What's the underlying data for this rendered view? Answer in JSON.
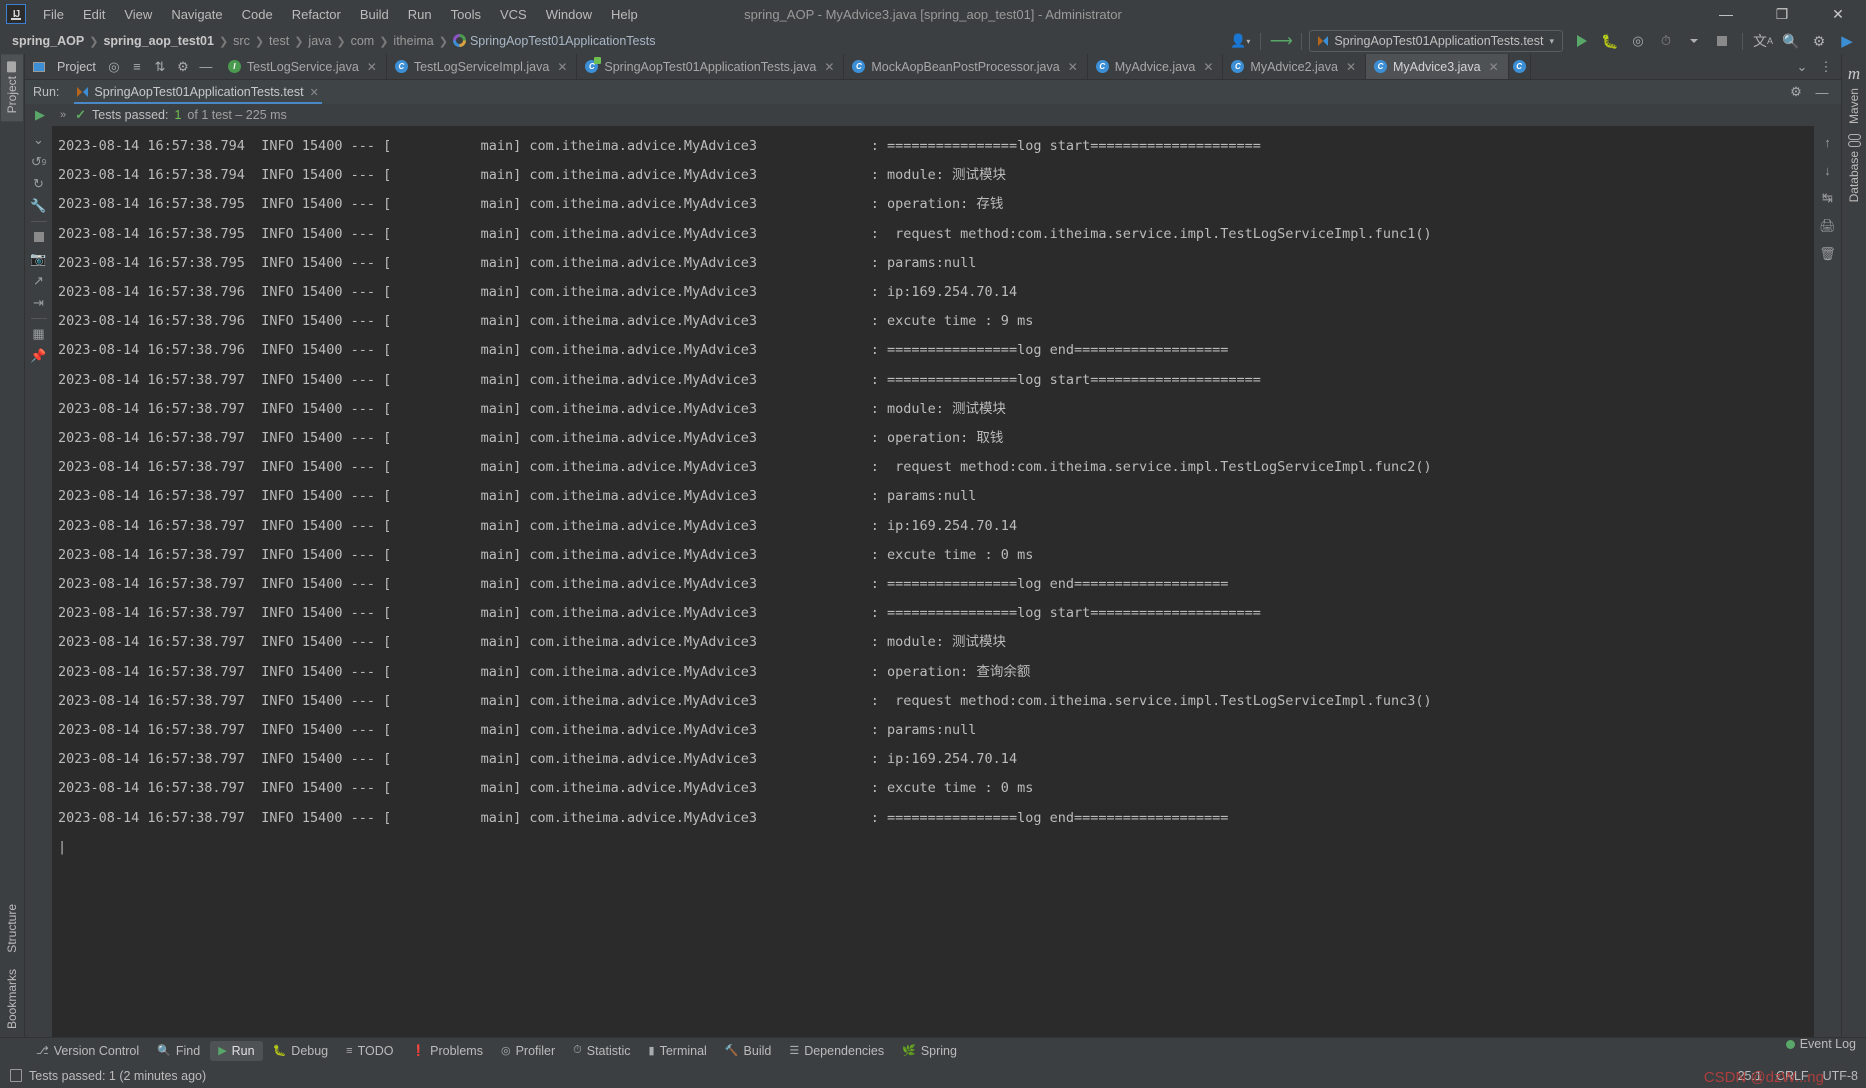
{
  "window": {
    "title": "spring_AOP - MyAdvice3.java [spring_aop_test01] - Administrator",
    "minimize": "—",
    "maximize": "❐",
    "close": "✕"
  },
  "menubar": {
    "items": [
      "File",
      "Edit",
      "View",
      "Navigate",
      "Code",
      "Refactor",
      "Build",
      "Run",
      "Tools",
      "VCS",
      "Window",
      "Help"
    ]
  },
  "breadcrumb": {
    "items": [
      {
        "label": "spring_AOP",
        "style": "bold"
      },
      {
        "label": "spring_aop_test01",
        "style": "bold"
      },
      {
        "label": "src",
        "style": "dim"
      },
      {
        "label": "test",
        "style": "dim"
      },
      {
        "label": "java",
        "style": "dim"
      },
      {
        "label": "com",
        "style": "dim"
      },
      {
        "label": "itheima",
        "style": "dim"
      },
      {
        "label": "SpringAopTest01ApplicationTests",
        "style": "file"
      }
    ],
    "separator": "❯"
  },
  "toolbar": {
    "profile_icon": "user-profile-icon",
    "vcs_update_icon": "vcs-update-arrow-icon",
    "run_config": "SpringAopTest01ApplicationTests.test",
    "run_config_caret": "▾",
    "run_button": "run-icon",
    "debug_button": "debug-icon",
    "run_coverage_button": "run-with-coverage-icon",
    "profiler_button": "profiler-icon",
    "profiler_caret": "▾",
    "stop_button": "stop-icon",
    "translate_button": "translate-icon",
    "search_button": "search-everywhere-icon",
    "settings_button": "settings-gear-icon",
    "ide_logo": "intellij-logo-icon"
  },
  "project_stripe": {
    "label": "Project",
    "icon": "folder-icon",
    "bottom": [
      {
        "label": "Structure",
        "icon": "structure-icon"
      },
      {
        "label": "Bookmarks",
        "icon": "bookmarks-icon"
      }
    ]
  },
  "right_stripe": {
    "maven": "Maven",
    "maven_icon": "maven-m-icon",
    "database": "Database",
    "database_icon": "database-icon"
  },
  "project_toolwindow": {
    "title": "Project",
    "icon": "project-window-icon",
    "actions": [
      "select-opened-file-icon",
      "collapse-all-icon",
      "sort-icon",
      "settings-gear-icon",
      "hide-icon"
    ]
  },
  "editor_tabs": [
    {
      "label": "TestLogService.java",
      "icon": "interface-icon",
      "icon_kind": "iface",
      "active": false
    },
    {
      "label": "TestLogServiceImpl.java",
      "icon": "class-icon",
      "icon_kind": "cls",
      "active": false
    },
    {
      "label": "SpringAopTest01ApplicationTests.java",
      "icon": "test-class-icon",
      "icon_kind": "test",
      "active": false
    },
    {
      "label": "MockAopBeanPostProcessor.java",
      "icon": "class-icon",
      "icon_kind": "cls",
      "active": false
    },
    {
      "label": "MyAdvice.java",
      "icon": "class-icon",
      "icon_kind": "cls",
      "active": false
    },
    {
      "label": "MyAdvice2.java",
      "icon": "class-icon",
      "icon_kind": "cls",
      "active": false
    },
    {
      "label": "MyAdvice3.java",
      "icon": "class-icon",
      "icon_kind": "cls",
      "active": true
    }
  ],
  "editor_tabs_close": "✕",
  "editor_tabs_right": {
    "chevron": "⌄",
    "more": "⋮"
  },
  "run_window": {
    "label": "Run:",
    "tab_title": "SpringAopTest01ApplicationTests.test",
    "tab_close": "✕",
    "settings_icon": "settings-gear-icon",
    "hide_icon": "hide-window-icon",
    "expand_chevron": "»",
    "collapse_chevron": "⌄",
    "status_check": "✓",
    "status_passed": "Tests passed:",
    "status_count": "1",
    "status_detail": "of 1 test – 225 ms"
  },
  "run_gutter_icons": [
    "rerun-icon",
    "rerun-failed-icon",
    "rerun-auto-icon",
    "run-settings-wrench-icon",
    "stop-icon",
    "screenshot-icon",
    "export-icon",
    "import-icon",
    "layout-icon",
    "pin-icon"
  ],
  "console_right_icons": [
    "scroll-up-icon",
    "scroll-down-icon",
    "print-icon",
    "trash-icon"
  ],
  "console": {
    "lines": [
      "2023-08-14 16:57:38.794  INFO 15400 --- [           main] com.itheima.advice.MyAdvice3              : ================log start=====================",
      "2023-08-14 16:57:38.794  INFO 15400 --- [           main] com.itheima.advice.MyAdvice3              : module: 测试模块",
      "2023-08-14 16:57:38.795  INFO 15400 --- [           main] com.itheima.advice.MyAdvice3              : operation: 存钱",
      "2023-08-14 16:57:38.795  INFO 15400 --- [           main] com.itheima.advice.MyAdvice3              :  request method:com.itheima.service.impl.TestLogServiceImpl.func1()",
      "2023-08-14 16:57:38.795  INFO 15400 --- [           main] com.itheima.advice.MyAdvice3              : params:null",
      "2023-08-14 16:57:38.796  INFO 15400 --- [           main] com.itheima.advice.MyAdvice3              : ip:169.254.70.14",
      "2023-08-14 16:57:38.796  INFO 15400 --- [           main] com.itheima.advice.MyAdvice3              : excute time : 9 ms",
      "2023-08-14 16:57:38.796  INFO 15400 --- [           main] com.itheima.advice.MyAdvice3              : ================log end===================",
      "2023-08-14 16:57:38.797  INFO 15400 --- [           main] com.itheima.advice.MyAdvice3              : ================log start=====================",
      "2023-08-14 16:57:38.797  INFO 15400 --- [           main] com.itheima.advice.MyAdvice3              : module: 测试模块",
      "2023-08-14 16:57:38.797  INFO 15400 --- [           main] com.itheima.advice.MyAdvice3              : operation: 取钱",
      "2023-08-14 16:57:38.797  INFO 15400 --- [           main] com.itheima.advice.MyAdvice3              :  request method:com.itheima.service.impl.TestLogServiceImpl.func2()",
      "2023-08-14 16:57:38.797  INFO 15400 --- [           main] com.itheima.advice.MyAdvice3              : params:null",
      "2023-08-14 16:57:38.797  INFO 15400 --- [           main] com.itheima.advice.MyAdvice3              : ip:169.254.70.14",
      "2023-08-14 16:57:38.797  INFO 15400 --- [           main] com.itheima.advice.MyAdvice3              : excute time : 0 ms",
      "2023-08-14 16:57:38.797  INFO 15400 --- [           main] com.itheima.advice.MyAdvice3              : ================log end===================",
      "2023-08-14 16:57:38.797  INFO 15400 --- [           main] com.itheima.advice.MyAdvice3              : ================log start=====================",
      "2023-08-14 16:57:38.797  INFO 15400 --- [           main] com.itheima.advice.MyAdvice3              : module: 测试模块",
      "2023-08-14 16:57:38.797  INFO 15400 --- [           main] com.itheima.advice.MyAdvice3              : operation: 查询余额",
      "2023-08-14 16:57:38.797  INFO 15400 --- [           main] com.itheima.advice.MyAdvice3              :  request method:com.itheima.service.impl.TestLogServiceImpl.func3()",
      "2023-08-14 16:57:38.797  INFO 15400 --- [           main] com.itheima.advice.MyAdvice3              : params:null",
      "2023-08-14 16:57:38.797  INFO 15400 --- [           main] com.itheima.advice.MyAdvice3              : ip:169.254.70.14",
      "2023-08-14 16:57:38.797  INFO 15400 --- [           main] com.itheima.advice.MyAdvice3              : excute time : 0 ms",
      "2023-08-14 16:57:38.797  INFO 15400 --- [           main] com.itheima.advice.MyAdvice3              : ================log end==================="
    ]
  },
  "toolwindow_bar": [
    {
      "label": "Version Control",
      "icon": "branch-icon",
      "active": false
    },
    {
      "label": "Find",
      "icon": "search-icon",
      "active": false
    },
    {
      "label": "Run",
      "icon": "run-triangle-icon",
      "active": true
    },
    {
      "label": "Debug",
      "icon": "bug-icon",
      "active": false
    },
    {
      "label": "TODO",
      "icon": "todo-list-icon",
      "active": false
    },
    {
      "label": "Problems",
      "icon": "problems-icon",
      "active": false
    },
    {
      "label": "Profiler",
      "icon": "profiler-icon",
      "active": false
    },
    {
      "label": "Statistic",
      "icon": "statistic-clock-icon",
      "active": false
    },
    {
      "label": "Terminal",
      "icon": "terminal-icon",
      "active": false
    },
    {
      "label": "Build",
      "icon": "build-hammer-icon",
      "active": false
    },
    {
      "label": "Dependencies",
      "icon": "dependencies-icon",
      "active": false
    },
    {
      "label": "Spring",
      "icon": "spring-leaf-icon",
      "active": false
    }
  ],
  "statusbar": {
    "message_icon": "message-icon",
    "message": "Tests passed: 1 (2 minutes ago)",
    "caret_position": "25:1",
    "line_separator": "CRLF",
    "encoding": "UTF-8",
    "event_log": "Event Log",
    "watermark": "CSDN @dzW...ng"
  },
  "colors": {
    "accent_blue": "#4a88c7",
    "green": "#59a869",
    "orange": "#cc7832",
    "console_bg": "#2b2b2b",
    "chrome_bg": "#3c3f41"
  }
}
